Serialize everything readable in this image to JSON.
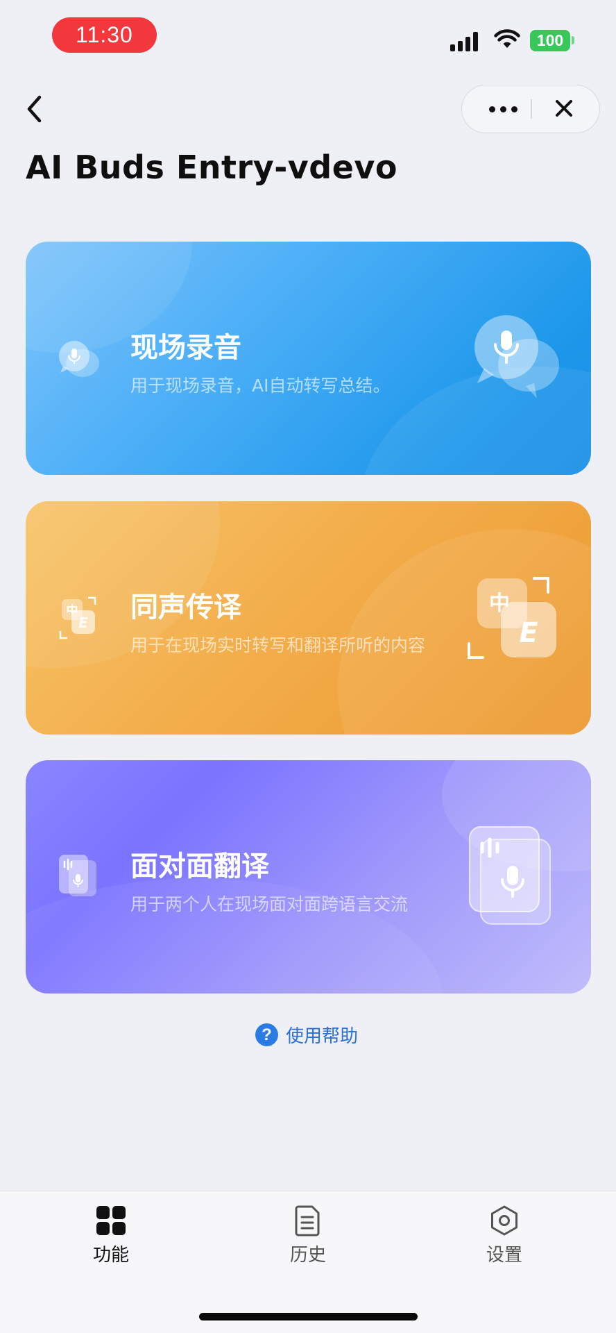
{
  "status_bar": {
    "time": "11:30",
    "battery": "100",
    "time_pill_color": "#f2383c",
    "battery_color": "#37c75a",
    "icons": [
      "cellular-signal-icon",
      "wifi-icon",
      "battery-icon"
    ]
  },
  "nav": {
    "back_icon": "chevron-left-icon",
    "more_icon": "more-dots-icon",
    "close_icon": "close-icon"
  },
  "page": {
    "title": "AI Buds Entry-vdevo"
  },
  "cards": [
    {
      "title": "现场录音",
      "description": "用于现场录音，AI自动转写总结。",
      "icon": "microphone-chat-bubble-icon",
      "color": "#1d97ea"
    },
    {
      "title": "同声传译",
      "description": "用于在现场实时转写和翻译所听的内容",
      "icon": "chinese-english-translate-icon",
      "color": "#ec982d"
    },
    {
      "title": "面对面翻译",
      "description": "用于两个人在现场面对面跨语言交流",
      "icon": "voice-cards-icon",
      "color": "#7b73ff"
    }
  ],
  "help": {
    "icon": "question-circle-icon",
    "label": "使用帮助",
    "color": "#2a7be4"
  },
  "tab_bar": {
    "active": "功能",
    "tabs": [
      {
        "label": "功能",
        "icon": "grid-icon"
      },
      {
        "label": "历史",
        "icon": "document-icon"
      },
      {
        "label": "设置",
        "icon": "hexagon-settings-icon"
      }
    ]
  }
}
